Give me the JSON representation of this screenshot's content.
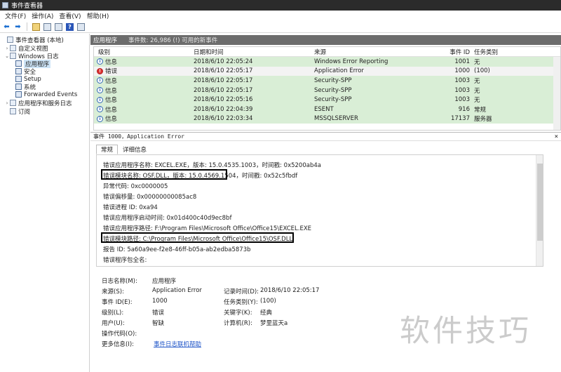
{
  "window": {
    "title": "事件查看器"
  },
  "menu": [
    "文件(F)",
    "操作(A)",
    "查看(V)",
    "帮助(H)"
  ],
  "tree": {
    "root": "事件查看器 (本地)",
    "custom_views": "自定义视图",
    "windows_logs": "Windows 日志",
    "application": "应用程序",
    "security": "安全",
    "setup": "Setup",
    "system": "系统",
    "forwarded": "Forwarded Events",
    "app_service_logs": "应用程序和服务日志",
    "subscriptions": "订阅"
  },
  "list": {
    "title": "应用程序",
    "count": "事件数: 26,986 (!) 可用的新事件",
    "columns": {
      "level": "级别",
      "datetime": "日期和时间",
      "source": "来源",
      "event_id": "事件 ID",
      "task": "任务类别"
    },
    "rows": [
      {
        "level": "信息",
        "datetime": "2018/6/10 22:05:24",
        "source": "Windows Error Reporting",
        "event_id": "1001",
        "task": "无"
      },
      {
        "level": "错误",
        "datetime": "2018/6/10 22:05:17",
        "source": "Application Error",
        "event_id": "1000",
        "task": "(100)"
      },
      {
        "level": "信息",
        "datetime": "2018/6/10 22:05:17",
        "source": "Security-SPP",
        "event_id": "1003",
        "task": "无"
      },
      {
        "level": "信息",
        "datetime": "2018/6/10 22:05:17",
        "source": "Security-SPP",
        "event_id": "1003",
        "task": "无"
      },
      {
        "level": "信息",
        "datetime": "2018/6/10 22:05:16",
        "source": "Security-SPP",
        "event_id": "1003",
        "task": "无"
      },
      {
        "level": "信息",
        "datetime": "2018/6/10 22:04:39",
        "source": "ESENT",
        "event_id": "916",
        "task": "常规"
      },
      {
        "level": "信息",
        "datetime": "2018/6/10 22:03:34",
        "source": "MSSQLSERVER",
        "event_id": "17137",
        "task": "服务器"
      }
    ]
  },
  "detail": {
    "title": "事件 1000，Application Error",
    "close": "×",
    "tabs": [
      "常规",
      "详细信息"
    ],
    "description": [
      "错误应用程序名称: EXCEL.EXE，版本: 15.0.4535.1003，时间戳: 0x5200ab4a",
      "错误模块名称: OSF.DLL，版本: 15.0.4569.1504，时间戳: 0x52c5fbdf",
      "异常代码: 0xc0000005",
      "错误偏移量: 0x00000000085ac8",
      "错误进程 ID: 0xa94",
      "错误应用程序启动时间: 0x01d400c40d9ec8bf",
      "错误应用程序路径: F:\\Program Files\\Microsoft Office\\Office15\\EXCEL.EXE",
      "错误模块路径: C:\\Program Files\\Microsoft Office\\Office15\\OSF.DLL",
      "报告 ID: 5a60a9ee-f2e8-46ff-b05a-ab2edba5873b",
      "错误程序包全名:"
    ],
    "props": {
      "log_name_label": "日志名称(M):",
      "log_name": "应用程序",
      "source_label": "来源(S):",
      "source": "Application Error",
      "logged_label": "记录时间(D):",
      "logged": "2018/6/10 22:05:17",
      "event_id_label": "事件 ID(E):",
      "event_id": "1000",
      "task_label": "任务类别(Y):",
      "task": "(100)",
      "level_label": "级别(L):",
      "level": "错误",
      "keywords_label": "关键字(K):",
      "keywords": "经典",
      "user_label": "用户(U):",
      "user": "智缺",
      "computer_label": "计算机(R):",
      "computer": "梦里蓝天a",
      "opcode_label": "操作代码(O):",
      "more_label": "更多信息(I):",
      "more_link": "事件日志联机帮助"
    }
  },
  "watermark": "软件技巧"
}
